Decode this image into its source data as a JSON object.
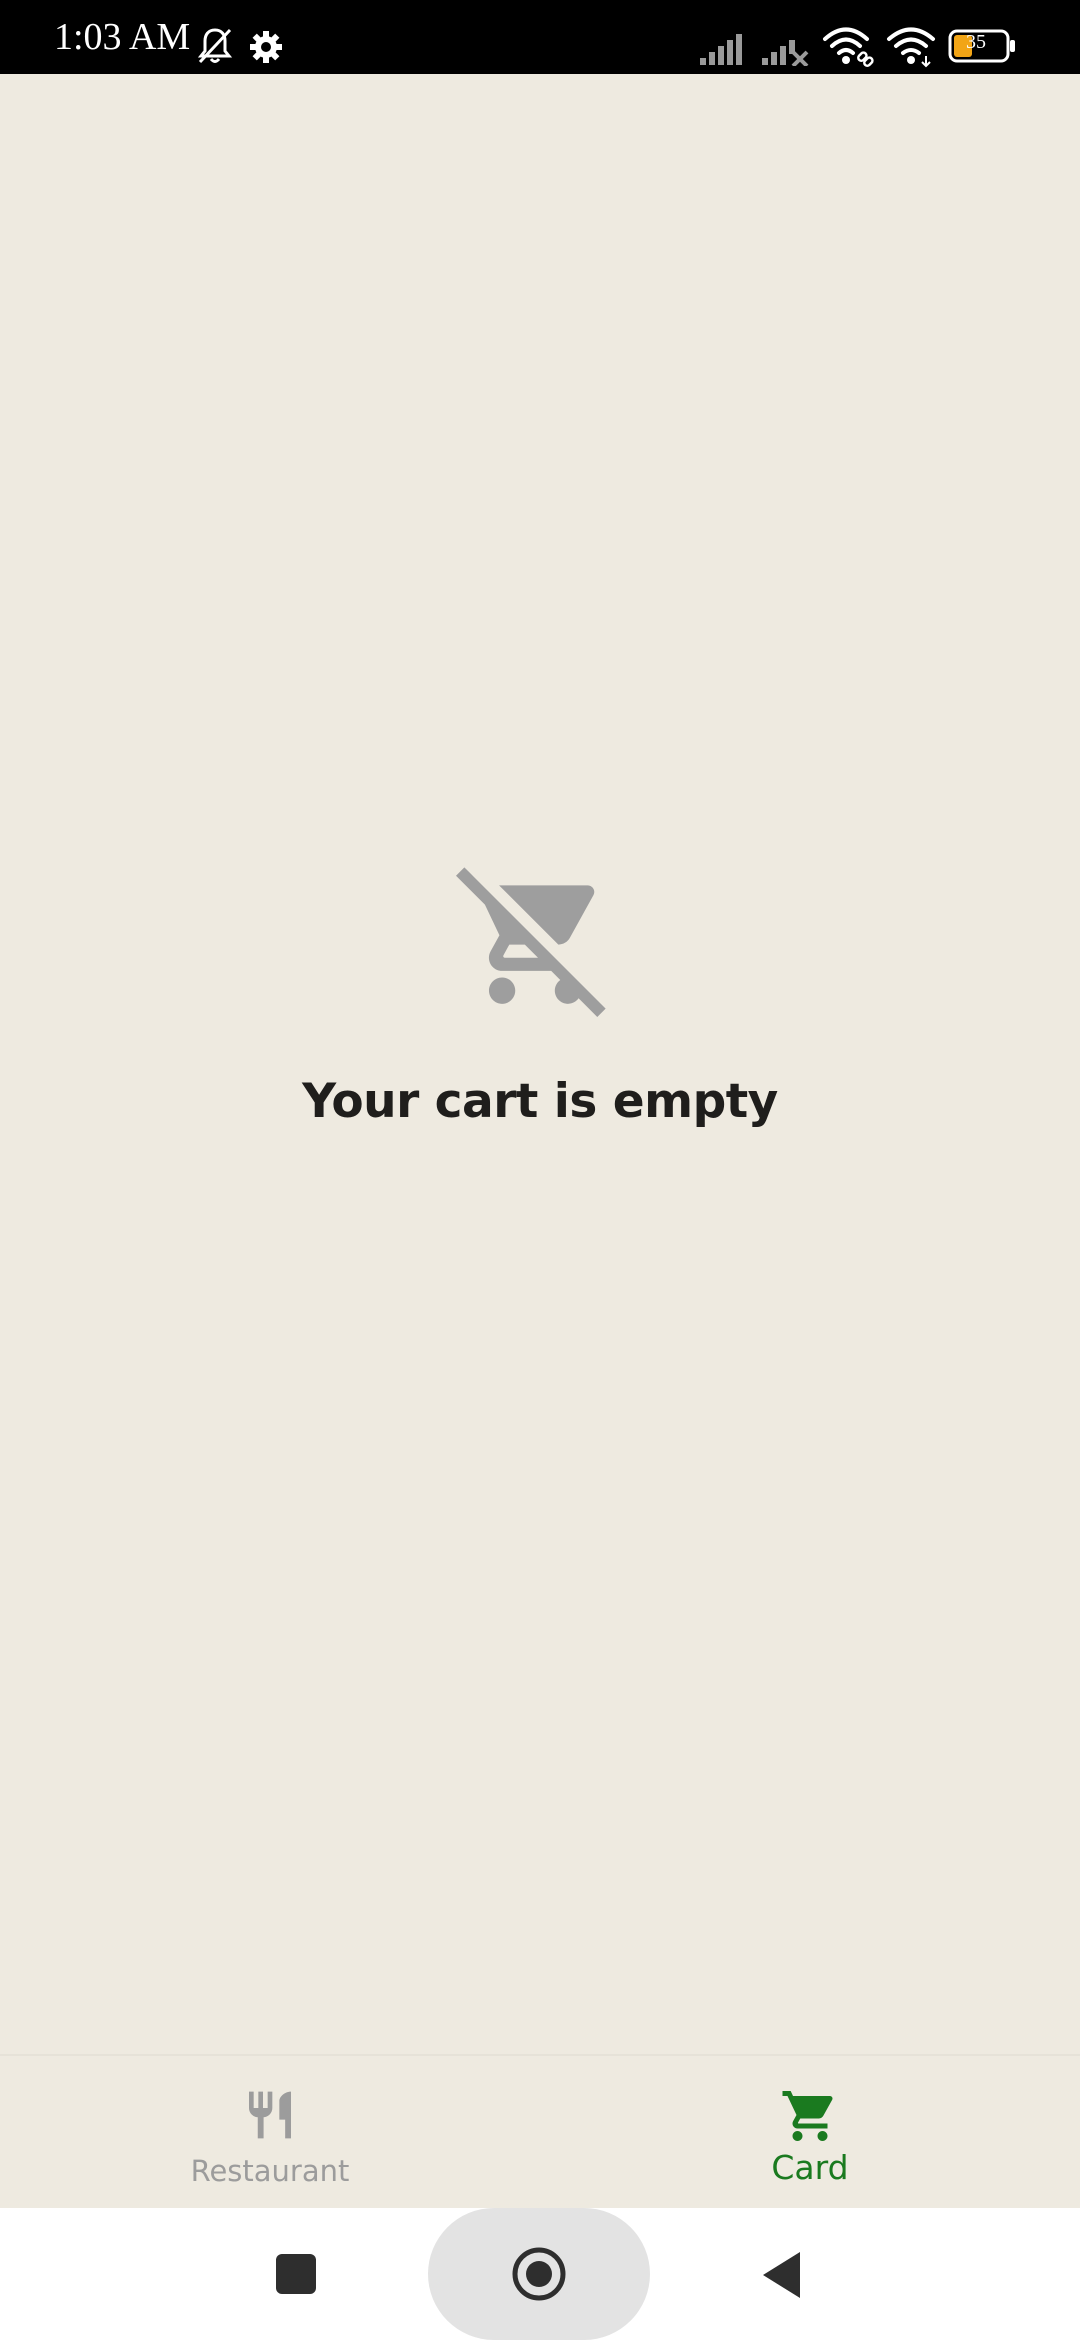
{
  "status_bar": {
    "time": "1:03 AM",
    "battery_level": "35",
    "icons": [
      "bell-off-icon",
      "gear-icon",
      "signal-icon",
      "signal-off-icon",
      "wifi-link-icon",
      "wifi-icon",
      "battery-icon"
    ]
  },
  "empty_state": {
    "icon": "remove-shopping-cart-icon",
    "message": "Your cart is empty"
  },
  "bottom_nav": {
    "items": [
      {
        "label": "Restaurant",
        "icon": "fork-knife-icon",
        "selected": false
      },
      {
        "label": "Card",
        "icon": "shopping-cart-icon",
        "selected": true
      }
    ]
  },
  "system_nav": {
    "buttons": [
      "recents-button",
      "home-button",
      "back-button"
    ]
  },
  "colors": {
    "background": "#EEEAE0",
    "accent": "#1A7A1F",
    "inactive": "#9C9C9C",
    "text": "#1F1E1C"
  }
}
